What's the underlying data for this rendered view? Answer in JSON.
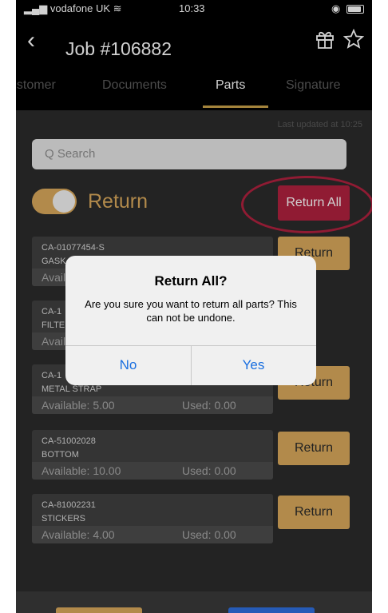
{
  "status_bar": {
    "carrier": "vodafone UK",
    "time": "10:33"
  },
  "header": {
    "back_icon": "‹",
    "title": "Job #106882"
  },
  "tabs": [
    {
      "label": "ustomer"
    },
    {
      "label": "Documents"
    },
    {
      "label": "Parts",
      "active": true
    },
    {
      "label": "Signature"
    }
  ],
  "last_updated": "Last updated at 10:25",
  "search": {
    "placeholder": "Q Search"
  },
  "return_toggle": {
    "label": "Return",
    "on": true
  },
  "return_all_label": "Return All",
  "parts": [
    {
      "code": "CA-01077454-S",
      "name": "GASK",
      "available": "Avail",
      "used": "",
      "button": "Return"
    },
    {
      "code": "CA-1",
      "name": "FILTE",
      "available": "Avail",
      "used": "",
      "button": ""
    },
    {
      "code": "CA-1",
      "name": "METAL STRAP",
      "available": "Available: 5.00",
      "used": "Used: 0.00",
      "button": "Return"
    },
    {
      "code": "CA-51002028",
      "name": "BOTTOM",
      "available": "Available: 10.00",
      "used": "Used: 0.00",
      "button": "Return"
    },
    {
      "code": "CA-81002231",
      "name": "STICKERS",
      "available": "Available: 4.00",
      "used": "Used: 0.00",
      "button": "Return"
    }
  ],
  "dialog": {
    "title": "Return All?",
    "message": "Are you sure you want to return all parts? This can not be undone.",
    "no_label": "No",
    "yes_label": "Yes"
  },
  "colors": {
    "accent": "#d9a95c",
    "danger": "#b0223f",
    "link": "#1a6fe0",
    "background": "#2b2b2b"
  }
}
